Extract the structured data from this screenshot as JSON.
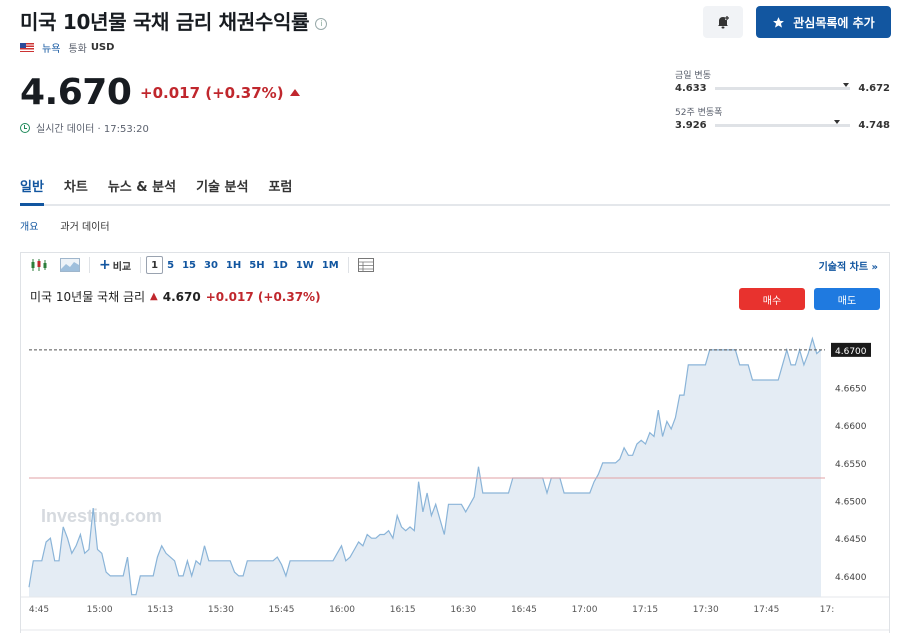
{
  "header": {
    "title": "미국 10년물 국채 금리 채권수익률",
    "exchange": "뉴욕",
    "currency_label": "통화",
    "currency": "USD"
  },
  "quote": {
    "price": "4.670",
    "change": "+0.017 (+0.37%)",
    "realtime": "실시간 데이터 · 17:53:20"
  },
  "actions": {
    "watchlist_label": "관심목록에 추가"
  },
  "ranges": {
    "day": {
      "label": "금일 변동",
      "low": "4.633",
      "high": "4.672",
      "position": 0.97
    },
    "week52": {
      "label": "52주 변동폭",
      "low": "3.926",
      "high": "4.748",
      "position": 0.9
    }
  },
  "tabs": [
    "일반",
    "차트",
    "뉴스 & 분석",
    "기술 분석",
    "포럼"
  ],
  "subtabs": [
    "개요",
    "과거 데이터"
  ],
  "toolbar": {
    "compare": "비교",
    "intervals": [
      "1",
      "5",
      "15",
      "30",
      "1H",
      "5H",
      "1D",
      "1W",
      "1M"
    ],
    "selected": "1",
    "tech_chart": "기술적 차트 »"
  },
  "chart_header": {
    "name": "미국 10년물 국채 금리",
    "value": "4.670",
    "change": "+0.017 (+0.37%)",
    "sell": "매수",
    "buy": "매도"
  },
  "chart_data": {
    "type": "area",
    "watermark": "Investing.com",
    "x_tick_labels": [
      "4:45",
      "15:00",
      "15:13",
      "15:30",
      "15:45",
      "16:00",
      "16:15",
      "16:30",
      "16:45",
      "17:00",
      "17:15",
      "17:30",
      "17:45",
      "17:"
    ],
    "y_tick_labels": [
      "4.6400",
      "4.6450",
      "4.6500",
      "4.6550",
      "4.6600",
      "4.6650"
    ],
    "ylim": [
      4.6372,
      4.6733
    ],
    "last_value": 4.67,
    "last_label": "4.6700",
    "prev_close": 4.653,
    "colors": {
      "line": "#8ab4d8",
      "fill": "#e4ecf4",
      "prev_close": "#e2a2a4",
      "current": "#555555"
    },
    "values": [
      4.6385,
      4.642,
      4.642,
      4.642,
      4.6445,
      4.645,
      4.642,
      4.642,
      4.6465,
      4.645,
      4.643,
      4.644,
      4.6455,
      4.643,
      4.6435,
      4.649,
      4.6435,
      4.643,
      4.6405,
      4.64,
      4.64,
      4.64,
      4.64,
      4.6425,
      4.6375,
      4.6375,
      4.64,
      4.64,
      4.64,
      4.64,
      4.6425,
      4.644,
      4.643,
      4.6425,
      4.642,
      4.64,
      4.64,
      4.642,
      4.64,
      4.642,
      4.6415,
      4.644,
      4.642,
      4.642,
      4.642,
      4.642,
      4.642,
      4.642,
      4.6405,
      4.64,
      4.64,
      4.642,
      4.642,
      4.642,
      4.642,
      4.642,
      4.642,
      4.642,
      4.6425,
      4.6415,
      4.64,
      4.642,
      4.642,
      4.642,
      4.642,
      4.642,
      4.642,
      4.642,
      4.642,
      4.642,
      4.642,
      4.642,
      4.643,
      4.644,
      4.642,
      4.6425,
      4.6435,
      4.6445,
      4.644,
      4.6455,
      4.645,
      4.645,
      4.6455,
      4.6455,
      4.646,
      4.645,
      4.648,
      4.6465,
      4.646,
      4.6465,
      4.646,
      4.6525,
      4.6485,
      4.651,
      4.648,
      4.6495,
      4.6475,
      4.6455,
      4.6495,
      4.6495,
      4.6495,
      4.6495,
      4.6485,
      4.6495,
      4.6505,
      4.6545,
      4.651,
      4.651,
      4.651,
      4.651,
      4.651,
      4.651,
      4.651,
      4.653,
      4.653,
      4.653,
      4.653,
      4.653,
      4.653,
      4.653,
      4.653,
      4.651,
      4.653,
      4.653,
      4.653,
      4.651,
      4.651,
      4.651,
      4.651,
      4.651,
      4.651,
      4.651,
      4.6525,
      4.6535,
      4.655,
      4.655,
      4.655,
      4.655,
      4.6555,
      4.657,
      4.656,
      4.656,
      4.6575,
      4.658,
      4.6575,
      4.659,
      4.6585,
      4.662,
      4.6585,
      4.6605,
      4.6595,
      4.661,
      4.664,
      4.664,
      4.668,
      4.668,
      4.668,
      4.668,
      4.668,
      4.67,
      4.67,
      4.67,
      4.67,
      4.67,
      4.67,
      4.67,
      4.668,
      4.668,
      4.668,
      4.666,
      4.666,
      4.666,
      4.666,
      4.666,
      4.666,
      4.666,
      4.668,
      4.67,
      4.668,
      4.668,
      4.67,
      4.668,
      4.6695,
      4.6715,
      4.6695,
      4.67
    ]
  }
}
